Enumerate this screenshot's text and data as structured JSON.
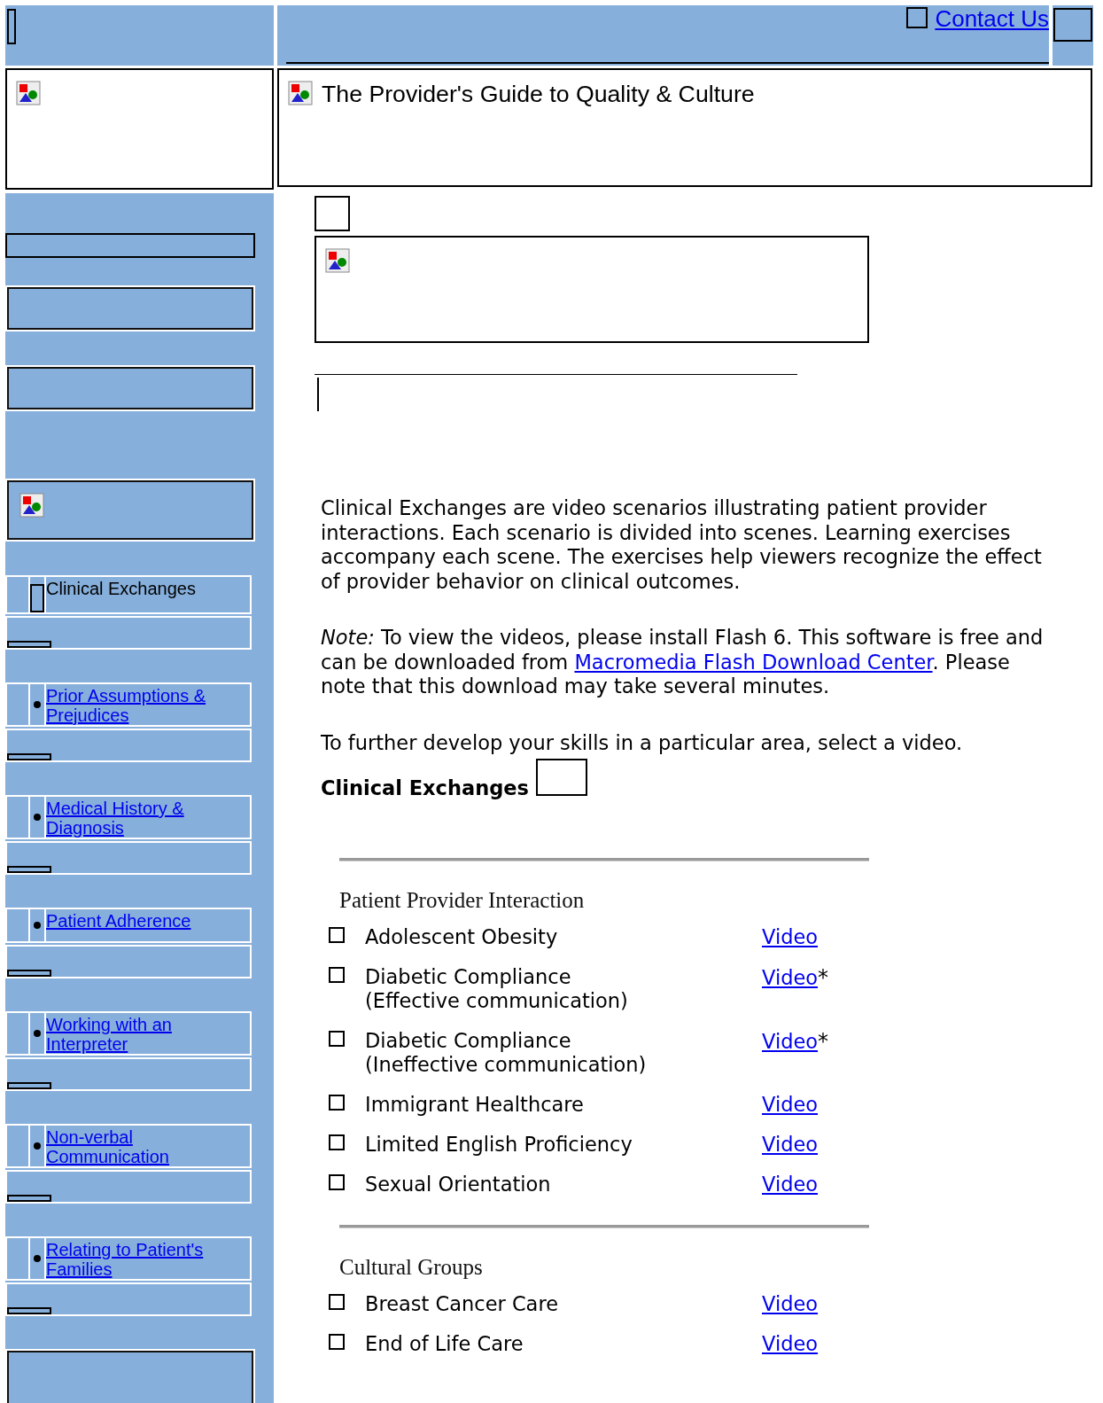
{
  "header": {
    "contact_link": "Contact Us"
  },
  "title": "The Provider's Guide to Quality & Culture",
  "sidebar": {
    "items": [
      {
        "kind": "current",
        "label": "Clinical Exchanges"
      },
      {
        "kind": "link",
        "label": "Prior Assumptions & Prejudices"
      },
      {
        "kind": "link",
        "label": "Medical History & Diagnosis"
      },
      {
        "kind": "link",
        "label": "Patient Adherence"
      },
      {
        "kind": "link",
        "label": "Working with an Interpreter"
      },
      {
        "kind": "link",
        "label": "Non-verbal Communication"
      },
      {
        "kind": "link",
        "label": "Relating to Patient's Families"
      }
    ]
  },
  "intro": "Clinical Exchanges are video scenarios illustrating patient provider interactions. Each scenario is divided into scenes. Learning exercises accompany each scene. The exercises help viewers recognize the effect of provider behavior on clinical outcomes.",
  "note": {
    "before": "*Note:* To view the videos, please install Flash 6. This software is free and can be downloaded from ",
    "link": "Macromedia Flash Download Center",
    "after": ". Please note that this download may take several minutes."
  },
  "instruction": "To further develop your skills in a particular area, select a video.",
  "section_heading": "Clinical Exchanges",
  "groups": [
    {
      "heading": "Patient Provider Interaction",
      "rows": [
        {
          "checked": false,
          "label": "Adolescent Obesity",
          "link": "Video"
        },
        {
          "checked": false,
          "label": "Diabetic Compliance (Effective communication)",
          "link": "Video",
          "marker": "*"
        },
        {
          "checked": false,
          "label": "Diabetic Compliance (Ineffective communication)",
          "link": "Video",
          "marker": "*"
        },
        {
          "checked": false,
          "label": "Immigrant Healthcare",
          "link": "Video"
        },
        {
          "checked": false,
          "label": "Limited English Proficiency",
          "link": "Video"
        },
        {
          "checked": false,
          "label": "Sexual Orientation",
          "link": "Video"
        }
      ]
    },
    {
      "heading": "Cultural Groups",
      "rows": [
        {
          "checked": false,
          "label": "Breast Cancer Care",
          "link": "Video"
        },
        {
          "checked": false,
          "label": "End of Life Care",
          "link": "Video"
        }
      ]
    }
  ]
}
